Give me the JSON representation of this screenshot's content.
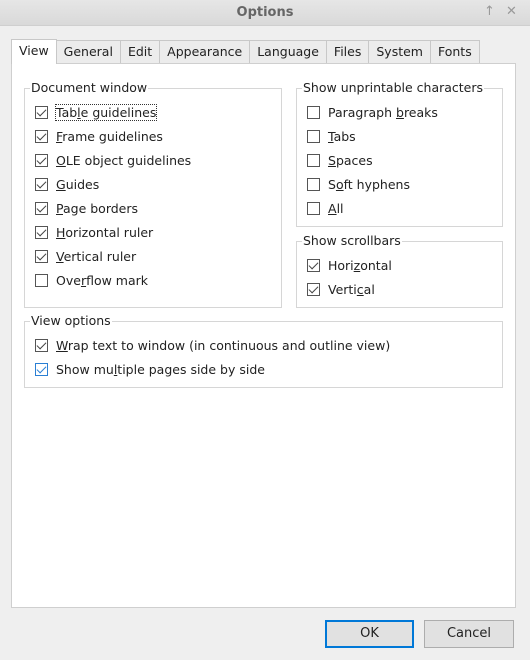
{
  "window": {
    "title": "Options",
    "pin_icon": "pin-icon",
    "close_icon": "close-icon",
    "pin_glyph": "↑",
    "close_glyph": "✕"
  },
  "tabs": [
    "View",
    "General",
    "Edit",
    "Appearance",
    "Language",
    "Files",
    "System",
    "Fonts"
  ],
  "active_tab": "View",
  "groups": {
    "document_window": {
      "title": "Document window",
      "items": [
        {
          "pre": "Tab",
          "key": "l",
          "post": "e guidelines",
          "checked": true,
          "focused": true
        },
        {
          "pre": "",
          "key": "F",
          "post": "rame guidelines",
          "checked": true
        },
        {
          "pre": "",
          "key": "O",
          "post": "LE object guidelines",
          "checked": true
        },
        {
          "pre": "",
          "key": "G",
          "post": "uides",
          "checked": true
        },
        {
          "pre": "",
          "key": "P",
          "post": "age borders",
          "checked": true
        },
        {
          "pre": "",
          "key": "H",
          "post": "orizontal ruler",
          "checked": true
        },
        {
          "pre": "",
          "key": "V",
          "post": "ertical ruler",
          "checked": true
        },
        {
          "pre": "Ove",
          "key": "r",
          "post": "flow mark",
          "checked": false
        }
      ]
    },
    "unprintable": {
      "title": "Show unprintable characters",
      "items": [
        {
          "pre": "Paragraph ",
          "key": "b",
          "post": "reaks",
          "checked": false
        },
        {
          "pre": "",
          "key": "T",
          "post": "abs",
          "checked": false
        },
        {
          "pre": "",
          "key": "S",
          "post": "paces",
          "checked": false
        },
        {
          "pre": "S",
          "key": "o",
          "post": "ft hyphens",
          "checked": false
        },
        {
          "pre": "",
          "key": "A",
          "post": "ll",
          "checked": false
        }
      ]
    },
    "scrollbars": {
      "title": "Show scrollbars",
      "items": [
        {
          "pre": "Hori",
          "key": "z",
          "post": "ontal",
          "checked": true
        },
        {
          "pre": "Verti",
          "key": "c",
          "post": "al",
          "checked": true
        }
      ]
    },
    "view_options": {
      "title": "View options",
      "items": [
        {
          "pre": "",
          "key": "W",
          "post": "rap text to window (in continuous and outline view)",
          "checked": true
        },
        {
          "pre": "Show mu",
          "key": "l",
          "post": "tiple pages side by side",
          "checked": true,
          "hover": true
        }
      ]
    }
  },
  "buttons": {
    "ok": "OK",
    "cancel": "Cancel"
  },
  "colors": {
    "accent": "#0078d7"
  }
}
